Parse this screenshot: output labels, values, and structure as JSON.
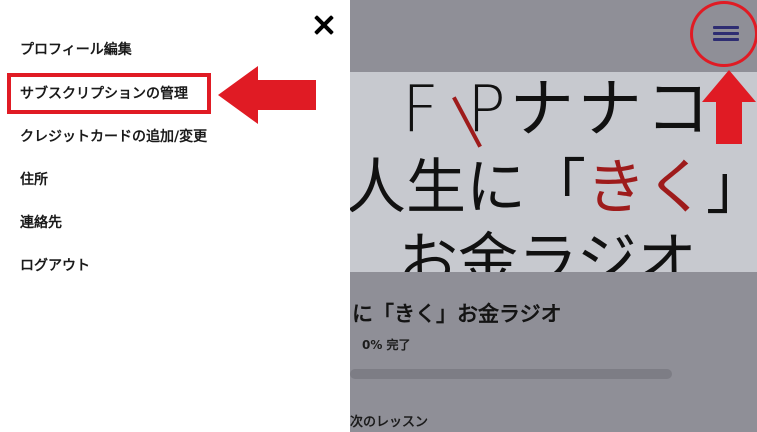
{
  "background": {
    "hero": {
      "line1_part1": "F",
      "line1_part2": "P",
      "line1_part3": "ナナコ",
      "line2_part1": "人生に「",
      "line2_red": "きく",
      "line2_part2": "」",
      "line3": "お金ラジオ"
    },
    "course_title": "に「きく」お金ラジオ",
    "progress_text": "0% 完了",
    "progress_fraction": 0,
    "next_lesson": "次のレッスン"
  },
  "drawer": {
    "menu": [
      {
        "label": "プロフィール編集"
      },
      {
        "label": "サブスクリプションの管理"
      },
      {
        "label": "クレジットカードの追加/変更"
      },
      {
        "label": "住所"
      },
      {
        "label": "連絡先"
      },
      {
        "label": "ログアウト"
      }
    ]
  },
  "icons": {
    "close": "close-icon",
    "menu": "hamburger-menu-icon"
  },
  "colors": {
    "annotation_red": "#e01b24",
    "overlay_gray": "#8f8f97",
    "hamburger": "#2e2d72",
    "hero_red_text": "#9e1b1b"
  }
}
